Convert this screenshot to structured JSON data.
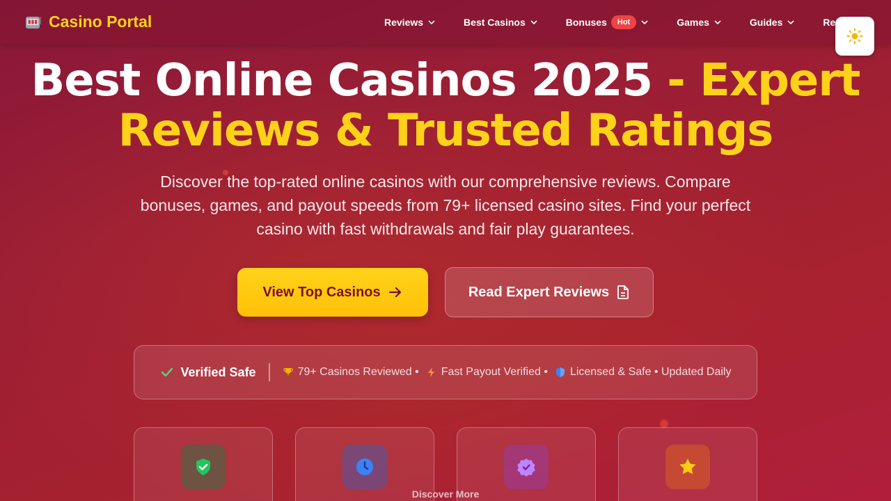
{
  "brand": {
    "name": "Casino Portal",
    "icon": "slot-machine-icon"
  },
  "nav": {
    "items": [
      {
        "label": "Reviews"
      },
      {
        "label": "Best Casinos"
      },
      {
        "label": "Bonuses",
        "badge": "Hot"
      },
      {
        "label": "Games"
      },
      {
        "label": "Guides"
      },
      {
        "label": "Regio"
      }
    ],
    "theme_toggle_icon": "sun-icon"
  },
  "hero": {
    "title_white": "Best Online Casinos 2025 ",
    "title_yellow_1": "- Expert",
    "title_yellow_2": "Reviews & Trusted Ratings",
    "subtitle": "Discover the top-rated online casinos with our comprehensive reviews. Compare bonuses, games, and payout speeds from 79+ licensed casino sites. Find your perfect casino with fast withdrawals and fair play guarantees.",
    "primary_button": "View Top Casinos",
    "secondary_button": "Read Expert Reviews"
  },
  "trust_bar": {
    "verified": "Verified Safe",
    "items": [
      {
        "icon": "trophy-icon",
        "text": "79+ Casinos Reviewed •"
      },
      {
        "icon": "lightning-icon",
        "text": "Fast Payout Verified •"
      },
      {
        "icon": "shield-icon",
        "text": "Licensed & Safe • Updated Daily"
      }
    ]
  },
  "features": [
    {
      "icon": "shield-check-icon",
      "color": "#22c55e"
    },
    {
      "icon": "clock-icon",
      "color": "#3b82f6"
    },
    {
      "icon": "badge-check-icon",
      "color": "#a855f7"
    },
    {
      "icon": "star-icon",
      "color": "#facc15"
    }
  ],
  "discover_more": "Discover More",
  "colors": {
    "accent": "#ffd21a",
    "background": "#9c1e34",
    "hot_badge": "#ef4444"
  }
}
